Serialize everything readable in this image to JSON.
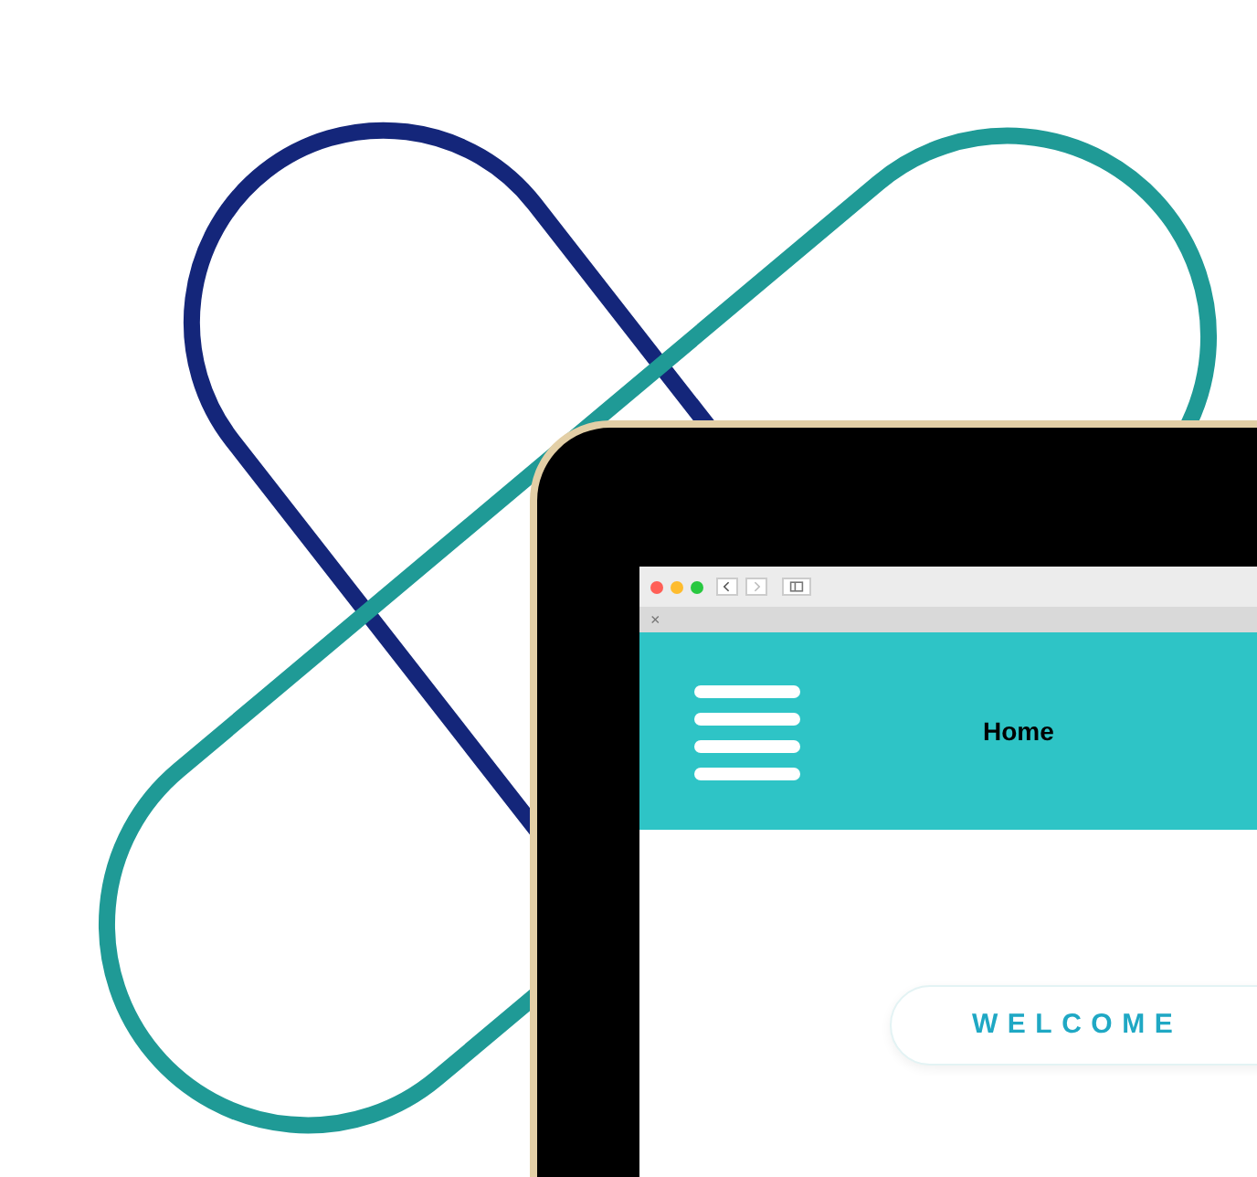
{
  "browser": {
    "tab_close": "×"
  },
  "site_header": {
    "nav_link": "Home"
  },
  "hero": {
    "badge": "WELCOME"
  }
}
